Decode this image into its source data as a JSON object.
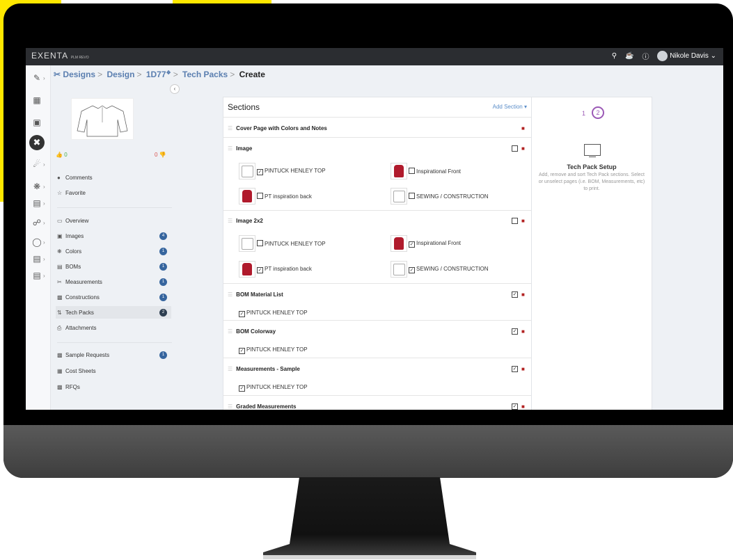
{
  "app": {
    "logo_main": "EXENTA",
    "logo_sub": "PLM REVO",
    "user_name": "Nikole Davis"
  },
  "icons": {
    "search": "search-icon",
    "bell": "bell-icon",
    "help": "help-icon"
  },
  "breadcrumb": {
    "designs": "Designs",
    "design": "Design",
    "item": "1D77",
    "tech_packs": "Tech Packs",
    "current": "Create"
  },
  "sidebar": {
    "likes": "0",
    "dislikes": "0",
    "comments": "Comments",
    "favorite": "Favorite",
    "items": [
      {
        "label": "Overview",
        "icon": "monitor-icon",
        "badge": ""
      },
      {
        "label": "Images",
        "icon": "image-icon",
        "badge": "4"
      },
      {
        "label": "Colors",
        "icon": "palette-icon",
        "badge": "1"
      },
      {
        "label": "BOMs",
        "icon": "list-icon",
        "badge": "1"
      },
      {
        "label": "Measurements",
        "icon": "ruler-icon",
        "badge": "1"
      },
      {
        "label": "Constructions",
        "icon": "document-icon",
        "badge": "1"
      },
      {
        "label": "Tech Packs",
        "icon": "tech-pack-icon",
        "badge": "2"
      },
      {
        "label": "Attachments",
        "icon": "paperclip-icon",
        "badge": ""
      }
    ],
    "items2": [
      {
        "label": "Sample Requests",
        "icon": "sample-icon",
        "badge": "1"
      },
      {
        "label": "Cost Sheets",
        "icon": "calculator-icon",
        "badge": ""
      },
      {
        "label": "RFQs",
        "icon": "rfq-icon",
        "badge": ""
      }
    ]
  },
  "sections": {
    "title": "Sections",
    "add_section": "Add Section ▾",
    "rows": [
      {
        "title": "Cover Page with Colors and Notes"
      },
      {
        "title": "Image"
      },
      {
        "title": "Image 2x2"
      },
      {
        "title": "BOM Material List"
      },
      {
        "title": "BOM Colorway"
      },
      {
        "title": "Measurements - Sample"
      },
      {
        "title": "Graded Measurements"
      }
    ],
    "image_opts": [
      {
        "label": "PINTUCK HENLEY TOP",
        "checked": true
      },
      {
        "label": "Inspirational Front",
        "checked": false
      },
      {
        "label": "PT inspiration back",
        "checked": false
      },
      {
        "label": "SEWING / CONSTRUCTION",
        "checked": false
      }
    ],
    "image2x2_opts": [
      {
        "label": "PINTUCK HENLEY TOP",
        "checked": false
      },
      {
        "label": "Inspirational Front",
        "checked": true
      },
      {
        "label": "PT inspiration back",
        "checked": true
      },
      {
        "label": "SEWING / CONSTRUCTION",
        "checked": true
      }
    ],
    "bom_material_opt": "PINTUCK HENLEY TOP",
    "bom_colorway_opt": "PINTUCK HENLEY TOP",
    "measurements_opt": "PINTUCK HENLEY TOP"
  },
  "setup": {
    "step1": "1",
    "step2": "2",
    "title": "Tech Pack Setup",
    "desc": "Add, remove and sort Tech Pack sections. Select or unselect pages (i.e. BOM, Measurements, etc) to print."
  }
}
